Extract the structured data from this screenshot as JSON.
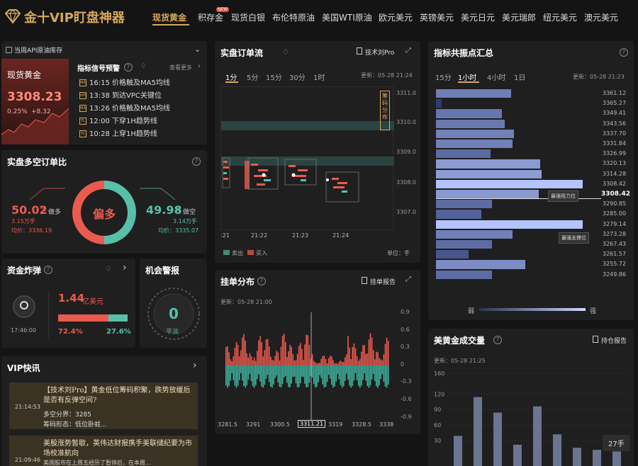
{
  "brand": {
    "title": "金十VIP盯盘神器"
  },
  "nav": {
    "items": [
      "现货黄金",
      "积存金",
      "现货白银",
      "布伦特原油",
      "美国WTI原油",
      "欧元美元",
      "英镑美元",
      "美元日元",
      "美元瑞郎",
      "纽元美元",
      "澳元美元"
    ],
    "new_badge": "NEW"
  },
  "oil": {
    "text": "当周API原油库存"
  },
  "quote": {
    "name": "现货黄金",
    "price": "3308.23",
    "change_pct": "0.25%",
    "change": "+8.32"
  },
  "signals": {
    "title": "指标信号预警",
    "more": "查看更多",
    "items": [
      {
        "icon": "MA",
        "time": "16:15",
        "text": "价格触及MA5均线"
      },
      {
        "icon": "VPC",
        "time": "13:38",
        "text": "到达VPC关键位"
      },
      {
        "icon": "MA",
        "time": "13:26",
        "text": "价格触及MA5均线"
      },
      {
        "icon": "TL",
        "time": "12:00",
        "text": "下穿1H趋势线"
      },
      {
        "icon": "TL",
        "time": "10:28",
        "text": "上穿1H趋势线"
      }
    ]
  },
  "longshort": {
    "title": "实盘多空订单比",
    "center": "偏多",
    "long_pct": "50.02",
    "long_label": "做多",
    "long_amount": "3.15万手",
    "long_avg": "均价：3336.19",
    "short_pct": "49.98",
    "short_label": "做空",
    "short_amount": "3.14万手",
    "short_avg": "均价：3335.07",
    "pct_sign": "%",
    "long_ratio": 0.5002
  },
  "fundbomb": {
    "title": "资金炸弹",
    "time": "17:46:00",
    "amount": "1.44",
    "unit": "亿美元",
    "red_pct": "72.4%",
    "teal_pct": "27.6%",
    "red_ratio": 0.724
  },
  "alert": {
    "title": "机会警报",
    "value": "0",
    "label": "平淡"
  },
  "vip": {
    "title": "VIP快讯",
    "items": [
      {
        "time": "21:14:53",
        "headline": "【技术刘Pro】黄金低位筹码积聚，跌势放缓后是否有反弹空间?",
        "line1": "多空分界：3285",
        "line2": "筹码形态：低位卧蛀..."
      },
      {
        "time": "21:09:46",
        "headline": "美股涨势暂歇，英伟达财报携手美联储纪要为市场校准航向",
        "line1": "美国股市在上周五经历了暂停后，在本周..."
      }
    ]
  },
  "orderflow": {
    "title": "实盘订单流",
    "pro": "技术刘Pro",
    "tabs": [
      "1分",
      "5分",
      "15分",
      "30分",
      "1时"
    ],
    "updated": "更新：05-28 21:24",
    "side_label": "筹码分布",
    "prices": [
      "3311.0",
      "3310.0",
      "3309.0",
      "3308.0",
      "3307.0"
    ],
    "times": [
      ":21",
      "21:22",
      "21:23",
      "21:24"
    ],
    "legend_sell": "卖出",
    "legend_buy": "买入",
    "unit": "单位：手"
  },
  "resonance": {
    "title": "指标共振点汇总",
    "tabs": [
      "15分",
      "1小时",
      "4小时",
      "1日"
    ],
    "updated": "更新：05-28 21:23",
    "levels": [
      "3361.12",
      "3365.27",
      "3349.41",
      "3343.56",
      "3337.70",
      "3331.84",
      "3326.99",
      "3320.13",
      "3314.28",
      "3308.42",
      "3296.71",
      "3290.85",
      "3285.00",
      "3279.14",
      "3273.28",
      "3267.43",
      "3261.57",
      "3255.72",
      "3249.86"
    ],
    "strengths": [
      0.51,
      0.04,
      0.45,
      0.47,
      0.53,
      0.52,
      0.37,
      0.71,
      0.72,
      1.0,
      0.7,
      0.38,
      0.31,
      1.0,
      0.52,
      0.38,
      0.22,
      0.61,
      0.38
    ],
    "current": "3308.42",
    "tip_resist": "最强阻力位",
    "tip_support": "最强支撑位",
    "weak": "弱",
    "strong": "强"
  },
  "pending": {
    "title": "挂单分布",
    "report": "挂单报告",
    "updated": "更新：05-28 21:00",
    "yticks": [
      "0.9",
      "0.6",
      "0.3",
      "0",
      "-0.3",
      "-0.6",
      "-0.9"
    ],
    "xticks": [
      "3281.5",
      "3291",
      "3300.5",
      "3311.21",
      "3319",
      "3328.5",
      "3338"
    ]
  },
  "volume": {
    "title": "美黄金成交量",
    "report": "持仓报告",
    "updated": "更新：05-28 21:25",
    "yticks": [
      "160",
      "120",
      "90",
      "60",
      "30"
    ],
    "values": [
      55,
      130,
      100,
      38,
      112,
      58,
      32,
      28,
      25
    ],
    "tooltip": "27手"
  }
}
